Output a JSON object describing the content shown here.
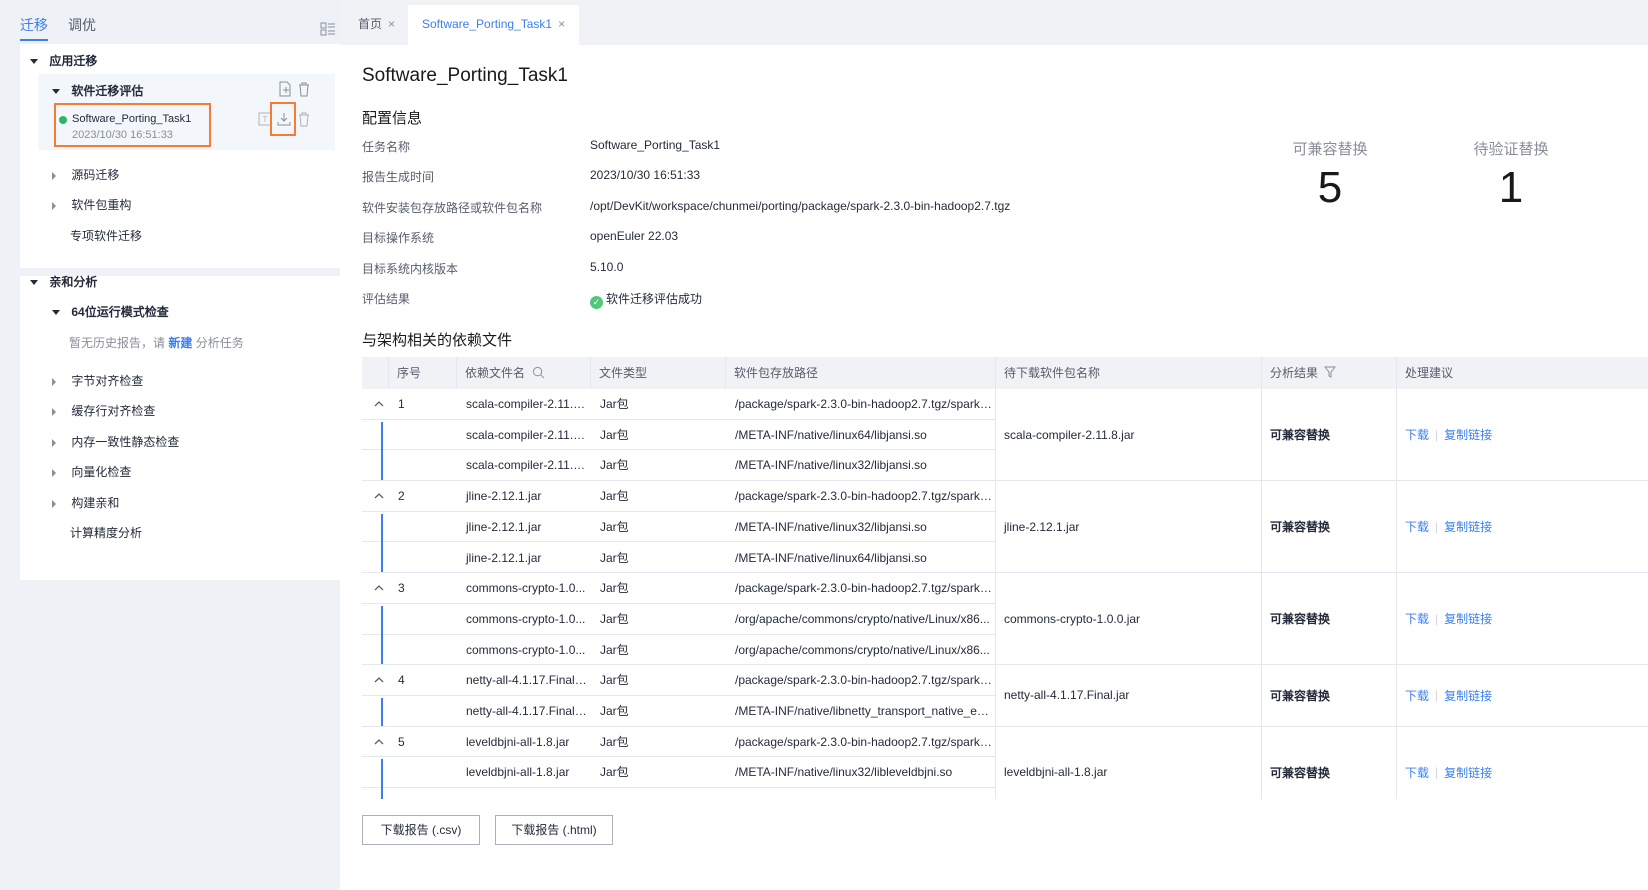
{
  "sidebar": {
    "tabs": [
      "迁移",
      "调优"
    ],
    "porting": {
      "group_title": "应用迁移",
      "eval_title": "软件迁移评估",
      "task_name": "Software_Porting_Task1",
      "task_time": "2023/10/30 16:51:33",
      "items": [
        "源码迁移",
        "软件包重构",
        "专项软件迁移"
      ]
    },
    "affinity": {
      "group_title": "亲和分析",
      "check_title": "64位运行模式检查",
      "empty_prefix": "暂无历史报告，请",
      "empty_link": "新建",
      "empty_suffix": "分析任务",
      "items": [
        "字节对齐检查",
        "缓存行对齐检查",
        "内存一致性静态检查",
        "向量化检查",
        "构建亲和",
        "计算精度分析"
      ]
    }
  },
  "tabs": [
    {
      "label": "首页",
      "close": "×"
    },
    {
      "label": "Software_Porting_Task1",
      "close": "×"
    }
  ],
  "main": {
    "title": "Software_Porting_Task1",
    "config_title": "配置信息",
    "config": [
      {
        "label": "任务名称",
        "value": "Software_Porting_Task1"
      },
      {
        "label": "报告生成时间",
        "value": "2023/10/30 16:51:33"
      },
      {
        "label": "软件安装包存放路径或软件包名称",
        "value": "/opt/DevKit/workspace/chunmei/porting/package/spark-2.3.0-bin-hadoop2.7.tgz"
      },
      {
        "label": "目标操作系统",
        "value": "openEuler 22.03"
      },
      {
        "label": "目标系统内核版本",
        "value": "5.10.0"
      },
      {
        "label": "评估结果",
        "value": "软件迁移评估成功"
      }
    ],
    "stats": [
      {
        "label": "可兼容替换",
        "value": "5"
      },
      {
        "label": "待验证替换",
        "value": "1"
      }
    ],
    "deps_title": "与架构相关的依赖文件",
    "table": {
      "headers": [
        "序号",
        "依赖文件名",
        "文件类型",
        "软件包存放路径",
        "待下载软件包名称",
        "分析结果",
        "处理建议"
      ],
      "groups": [
        {
          "index": "1",
          "package": "scala-compiler-2.11.8.jar",
          "result": "可兼容替换",
          "rows": [
            {
              "file": "scala-compiler-2.11.8...",
              "type": "Jar包",
              "path": "/package/spark-2.3.0-bin-hadoop2.7.tgz/spark-..."
            },
            {
              "file": "scala-compiler-2.11.8...",
              "type": "Jar包",
              "path": "/META-INF/native/linux64/libjansi.so"
            },
            {
              "file": "scala-compiler-2.11.8...",
              "type": "Jar包",
              "path": "/META-INF/native/linux32/libjansi.so"
            }
          ]
        },
        {
          "index": "2",
          "package": "jline-2.12.1.jar",
          "result": "可兼容替换",
          "rows": [
            {
              "file": "jline-2.12.1.jar",
              "type": "Jar包",
              "path": "/package/spark-2.3.0-bin-hadoop2.7.tgz/spark-..."
            },
            {
              "file": "jline-2.12.1.jar",
              "type": "Jar包",
              "path": "/META-INF/native/linux32/libjansi.so"
            },
            {
              "file": "jline-2.12.1.jar",
              "type": "Jar包",
              "path": "/META-INF/native/linux64/libjansi.so"
            }
          ]
        },
        {
          "index": "3",
          "package": "commons-crypto-1.0.0.jar",
          "result": "可兼容替换",
          "rows": [
            {
              "file": "commons-crypto-1.0...",
              "type": "Jar包",
              "path": "/package/spark-2.3.0-bin-hadoop2.7.tgz/spark-..."
            },
            {
              "file": "commons-crypto-1.0...",
              "type": "Jar包",
              "path": "/org/apache/commons/crypto/native/Linux/x86..."
            },
            {
              "file": "commons-crypto-1.0...",
              "type": "Jar包",
              "path": "/org/apache/commons/crypto/native/Linux/x86..."
            }
          ]
        },
        {
          "index": "4",
          "package": "netty-all-4.1.17.Final.jar",
          "result": "可兼容替换",
          "rows": [
            {
              "file": "netty-all-4.1.17.Final.j...",
              "type": "Jar包",
              "path": "/package/spark-2.3.0-bin-hadoop2.7.tgz/spark-..."
            },
            {
              "file": "netty-all-4.1.17.Final.j...",
              "type": "Jar包",
              "path": "/META-INF/native/libnetty_transport_native_ep..."
            }
          ]
        },
        {
          "index": "5",
          "package": "leveldbjni-all-1.8.jar",
          "result": "可兼容替换",
          "rows": [
            {
              "file": "leveldbjni-all-1.8.jar",
              "type": "Jar包",
              "path": "/package/spark-2.3.0-bin-hadoop2.7.tgz/spark-..."
            },
            {
              "file": "leveldbjni-all-1.8.jar",
              "type": "Jar包",
              "path": "/META-INF/native/linux32/libleveldbjni.so"
            },
            {
              "file": "",
              "type": "",
              "path": ""
            }
          ]
        }
      ],
      "action_download": "下载",
      "action_copy": "复制链接"
    },
    "buttons": [
      "下载报告 (.csv)",
      "下载报告 (.html)"
    ]
  },
  "colors": {
    "accent": "#3a7ff0",
    "highlight": "#f57c34",
    "success": "#2fb56a"
  }
}
